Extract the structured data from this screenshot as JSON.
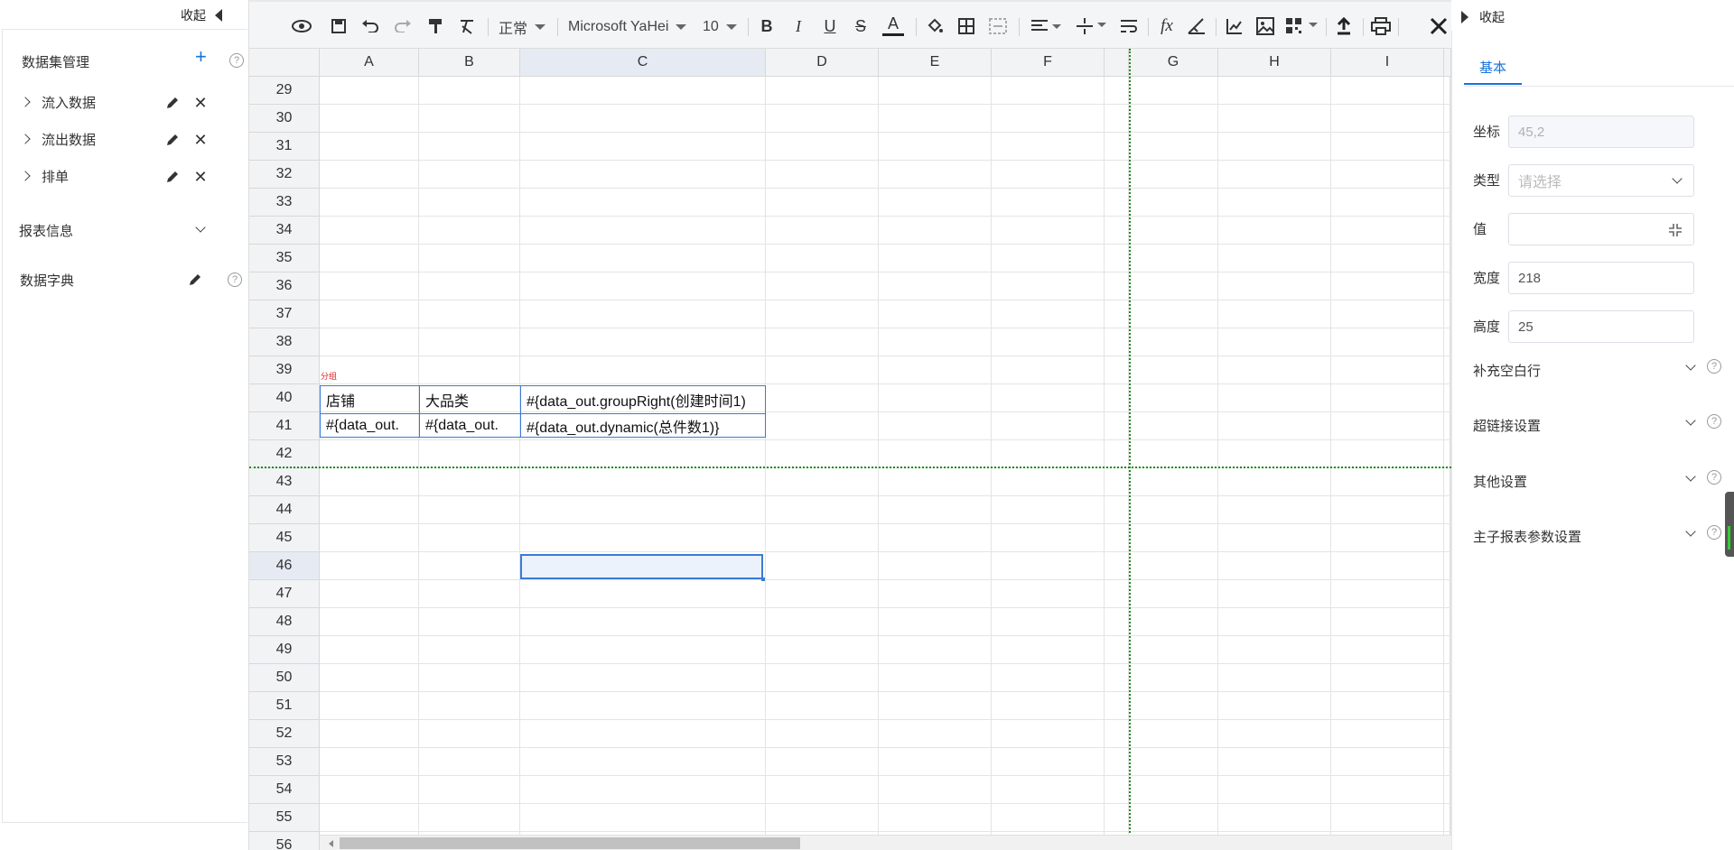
{
  "left_panel": {
    "collapse_label": "收起",
    "dataset_title": "数据集管理",
    "add_symbol": "+",
    "help_symbol": "?",
    "datasets": [
      {
        "label": "流入数据"
      },
      {
        "label": "流出数据"
      },
      {
        "label": "排单"
      }
    ],
    "report_info": "报表信息",
    "dictionary": "数据字典"
  },
  "toolbar": {
    "format_select": "正常",
    "font_select": "Microsoft YaHei",
    "size_select": "10",
    "bold": "B",
    "italic": "I",
    "underline": "U",
    "strike": "S",
    "font_color": "A",
    "fx": "fx",
    "icons": [
      "preview-icon",
      "save-icon",
      "undo-icon",
      "redo-icon",
      "format-painter-icon",
      "clear-format-icon",
      "bold-icon",
      "italic-icon",
      "underline-icon",
      "strikethrough-icon",
      "font-color-icon",
      "fill-color-icon",
      "borders-icon",
      "merge-cells-icon",
      "align-horizontal-icon",
      "align-vertical-icon",
      "wrap-text-icon",
      "function-icon",
      "formula-icon",
      "chart-icon",
      "image-icon",
      "qrcode-icon",
      "upload-icon",
      "print-icon",
      "tools-icon"
    ]
  },
  "sheet": {
    "columns": [
      "A",
      "B",
      "C",
      "D",
      "E",
      "F",
      "",
      "G",
      "H",
      "I"
    ],
    "rows": [
      "29",
      "30",
      "31",
      "32",
      "33",
      "34",
      "35",
      "36",
      "37",
      "38",
      "39",
      "40",
      "41",
      "42",
      "43",
      "44",
      "45",
      "46",
      "47",
      "48",
      "49",
      "50",
      "51",
      "52",
      "53",
      "54",
      "55",
      "56"
    ],
    "group_tag": "分组",
    "cells": {
      "A40": "店铺",
      "B40": "大品类",
      "C40": "#{data_out.groupRight(创建时间1)",
      "A41": "#{data_out.",
      "B41": "#{data_out.",
      "C41": "#{data_out.dynamic(总件数1)}"
    },
    "selected_row": "46",
    "colors": {
      "selection": "#3a7bd5",
      "freeze_line": "#1a8a1a",
      "group_tag": "#e02020"
    }
  },
  "right_panel": {
    "collapse_label": "收起",
    "tab": "基本",
    "fields": {
      "coord_label": "坐标",
      "coord_value": "45,2",
      "type_label": "类型",
      "type_placeholder": "请选择",
      "value_label": "值",
      "value_value": "",
      "width_label": "宽度",
      "width_value": "218",
      "height_label": "高度",
      "height_value": "25"
    },
    "sections": [
      "补充空白行",
      "超链接设置",
      "其他设置",
      "主子报表参数设置"
    ],
    "accent": "#1a73d9"
  }
}
